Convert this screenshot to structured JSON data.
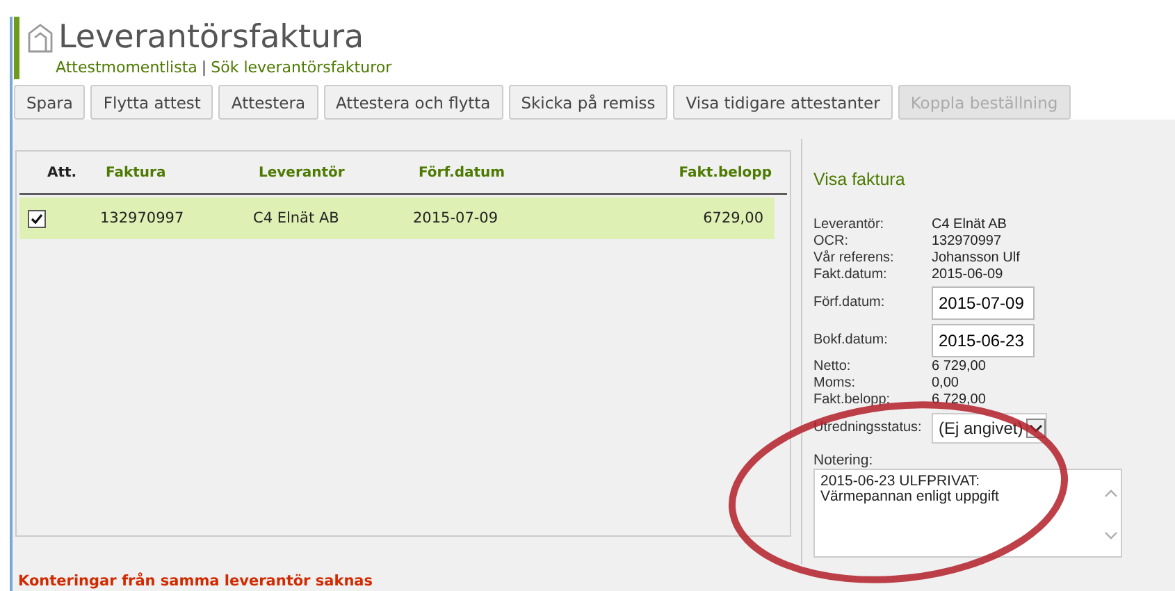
{
  "header": {
    "title": "Leverantörsfaktura",
    "links": [
      "Attestmomentlista",
      "Sök leverantörsfakturor"
    ],
    "separator": "|"
  },
  "toolbar": {
    "buttons": [
      {
        "label": "Spara",
        "disabled": false
      },
      {
        "label": "Flytta attest",
        "disabled": false
      },
      {
        "label": "Attestera",
        "disabled": false
      },
      {
        "label": "Attestera och flytta",
        "disabled": false
      },
      {
        "label": "Skicka på remiss",
        "disabled": false
      },
      {
        "label": "Visa tidigare attestanter",
        "disabled": false
      },
      {
        "label": "Koppla beställning",
        "disabled": true
      }
    ]
  },
  "table": {
    "check_column": "Att.",
    "columns": [
      "Faktura",
      "Leverantör",
      "Förf.datum",
      "Fakt.belopp"
    ],
    "rows": [
      {
        "checked": true,
        "selected": true,
        "cells": [
          "132970997",
          "C4 Elnät AB",
          "2015-07-09",
          "6729,00"
        ]
      }
    ]
  },
  "details": {
    "title": "Visa faktura",
    "fields": [
      {
        "kind": "text",
        "label": "Leverantör:",
        "value": "C4 Elnät AB"
      },
      {
        "kind": "text",
        "label": "OCR:",
        "value": "132970997"
      },
      {
        "kind": "text",
        "label": "Vår referens:",
        "value": "Johansson Ulf"
      },
      {
        "kind": "text",
        "label": "Fakt.datum:",
        "value": "2015-06-09"
      },
      {
        "kind": "input",
        "label": "Förf.datum:",
        "value": "2015-07-09"
      },
      {
        "kind": "input",
        "label": "Bokf.datum:",
        "value": "2015-06-23"
      },
      {
        "kind": "text",
        "label": "Netto:",
        "value": "6 729,00"
      },
      {
        "kind": "text",
        "label": "Moms:",
        "value": "0,00"
      },
      {
        "kind": "text",
        "label": "Fakt.belopp:",
        "value": "6 729,00"
      }
    ],
    "status": {
      "label": "Utredningsstatus:",
      "value": "(Ej angivet)"
    },
    "note": {
      "label": "Notering:",
      "value": "2015-06-23 ULFPRIVAT:\nVärmepannan enligt uppgift"
    }
  },
  "message": "Konteringar från samma leverantör saknas"
}
